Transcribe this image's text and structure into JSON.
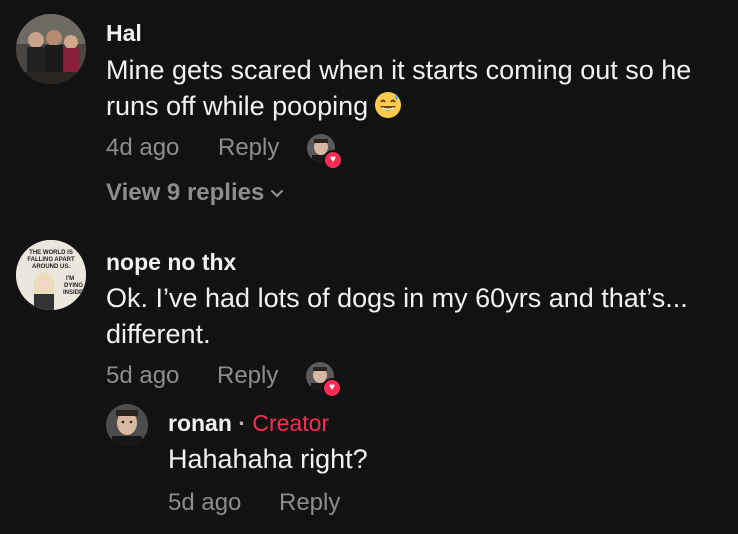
{
  "comments": [
    {
      "username": "Hal",
      "text": "Mine gets scared when it starts coming out so he runs off while pooping",
      "emoji": "grinning-sweat-emoji",
      "time": "4d ago",
      "reply_label": "Reply",
      "liked_by_creator": true,
      "view_replies": "View 9 replies"
    },
    {
      "username": "nope no thx",
      "avatar_text": [
        "THE WORLD IS",
        "FALLING APART",
        "AROUND US.",
        "I'M",
        "DYING",
        "INSIDE"
      ],
      "text": "Ok. I’ve had lots of dogs in my 60yrs and that’s... different.",
      "time": "5d ago",
      "reply_label": "Reply",
      "liked_by_creator": true
    }
  ],
  "reply": {
    "username": "ronan",
    "separator": "·",
    "badge": "Creator",
    "text": "Hahahaha right?",
    "time": "5d ago",
    "reply_label": "Reply"
  },
  "colors": {
    "background": "#121212",
    "text": "#f2f2f2",
    "meta": "#8d8d8d",
    "accent": "#fe2c55"
  }
}
